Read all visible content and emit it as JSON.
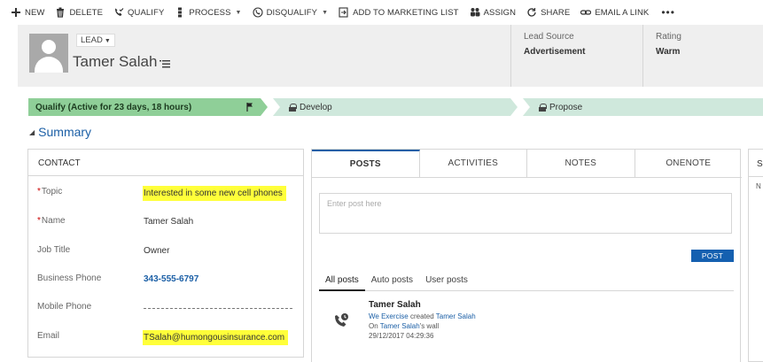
{
  "commandbar": {
    "new": "NEW",
    "delete": "DELETE",
    "qualify": "QUALIFY",
    "process": "PROCESS",
    "disqualify": "DISQUALIFY",
    "add_to_marketing_list": "ADD TO MARKETING LIST",
    "assign": "ASSIGN",
    "share": "SHARE",
    "email_a_link": "EMAIL A LINK",
    "more": "•••"
  },
  "header": {
    "entity": "LEAD",
    "record_name": "Tamer Salah",
    "lead_source_label": "Lead Source",
    "lead_source_value": "Advertisement",
    "rating_label": "Rating",
    "rating_value": "Warm"
  },
  "process": {
    "stages": [
      {
        "label": "Qualify (Active for 23 days, 18 hours)"
      },
      {
        "label": "Develop"
      },
      {
        "label": "Propose"
      }
    ]
  },
  "summary": {
    "title": "Summary"
  },
  "contact": {
    "heading": "CONTACT",
    "fields": [
      {
        "label": "Topic",
        "value": "Interested in some new cell phones"
      },
      {
        "label": "Name",
        "value": "Tamer Salah"
      },
      {
        "label": "Job Title",
        "value": "Owner"
      },
      {
        "label": "Business Phone",
        "value": "343-555-6797"
      },
      {
        "label": "Mobile Phone",
        "value": ""
      },
      {
        "label": "Email",
        "value": "TSalah@humongousinsurance.com"
      }
    ]
  },
  "posts": {
    "tabs": [
      "POSTS",
      "ACTIVITIES",
      "NOTES",
      "ONENOTE"
    ],
    "placeholder": "Enter post here",
    "post_button": "POST",
    "subtabs": [
      "All posts",
      "Auto posts",
      "User posts"
    ],
    "entry": {
      "author": "Tamer Salah",
      "actor": "We Exercise",
      "created_text": "created",
      "target": "Tamer Salah",
      "on_text": "On",
      "wall_target": "Tamer Salah",
      "wall_suffix": "'s wall",
      "timestamp": "29/12/2017 04:29:36"
    }
  },
  "right_panel": {
    "heading_fragment": "S",
    "sub_fragment": "N"
  },
  "colors": {
    "accent": "#1b5fa6",
    "active_stage": "#8fcf98",
    "inactive_stage": "#cfe8dc",
    "highlight": "#ffff3a"
  }
}
